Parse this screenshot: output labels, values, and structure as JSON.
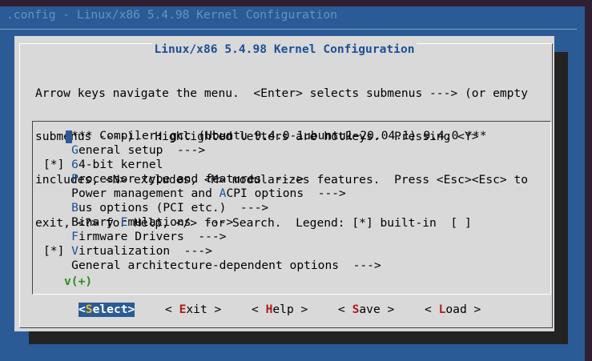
{
  "window": {
    "title": ".config - Linux/x86 5.4.98 Kernel Configuration"
  },
  "dialog": {
    "title": "Linux/x86 5.4.98 Kernel Configuration",
    "help_lines": [
      "Arrow keys navigate the menu.  <Enter> selects submenus ---> (or empty",
      "submenus ----).  Highlighted letters are hotkeys.  Pressing <Y>",
      "includes, <N> excludes, <M> modularizes features.  Press <Esc><Esc> to",
      "exit, <?> for Help, </> for Search.  Legend: [*] built-in  [ ]"
    ]
  },
  "menu": {
    "items": [
      {
        "prefix": "    ",
        "pre": "",
        "hk": "",
        "post": "*** Compiler: gcc (Ubuntu 9.4.0-1ubuntu1~20.04.1) 9.4.0 ***",
        "selected": true
      },
      {
        "prefix": "    ",
        "pre": "",
        "hk": "G",
        "post": "eneral setup  --->",
        "selected": false
      },
      {
        "prefix": "[*] ",
        "pre": "",
        "hk": "6",
        "post": "4-bit kernel",
        "selected": false
      },
      {
        "prefix": "    ",
        "pre": "",
        "hk": "P",
        "post": "rocessor type and features  --->",
        "selected": false
      },
      {
        "prefix": "    ",
        "pre": "Power management and ",
        "hk": "A",
        "post": "CPI options  --->",
        "selected": false
      },
      {
        "prefix": "    ",
        "pre": "",
        "hk": "B",
        "post": "us options (PCI etc.)  --->",
        "selected": false
      },
      {
        "prefix": "    ",
        "pre": "Binary ",
        "hk": "E",
        "post": "mulations  --->",
        "selected": false
      },
      {
        "prefix": "    ",
        "pre": "",
        "hk": "F",
        "post": "irmware Drivers  --->",
        "selected": false
      },
      {
        "prefix": "[*] ",
        "pre": "",
        "hk": "V",
        "post": "irtualization  --->",
        "selected": false
      },
      {
        "prefix": "    ",
        "pre": "General architecture-dependent options  --->",
        "hk": "",
        "post": "",
        "selected": false
      }
    ],
    "more_indicator": "v(+)"
  },
  "buttons": [
    {
      "open": "<",
      "hk": "S",
      "rest": "elect",
      "close": ">",
      "active": true
    },
    {
      "open": "< ",
      "hk": "E",
      "rest": "xit",
      "close": " >",
      "active": false
    },
    {
      "open": "< ",
      "hk": "H",
      "rest": "elp",
      "close": " >",
      "active": false
    },
    {
      "open": "< ",
      "hk": "S",
      "rest": "ave",
      "close": " >",
      "active": false
    },
    {
      "open": "< ",
      "hk": "L",
      "rest": "oad",
      "close": " >",
      "active": false
    }
  ]
}
